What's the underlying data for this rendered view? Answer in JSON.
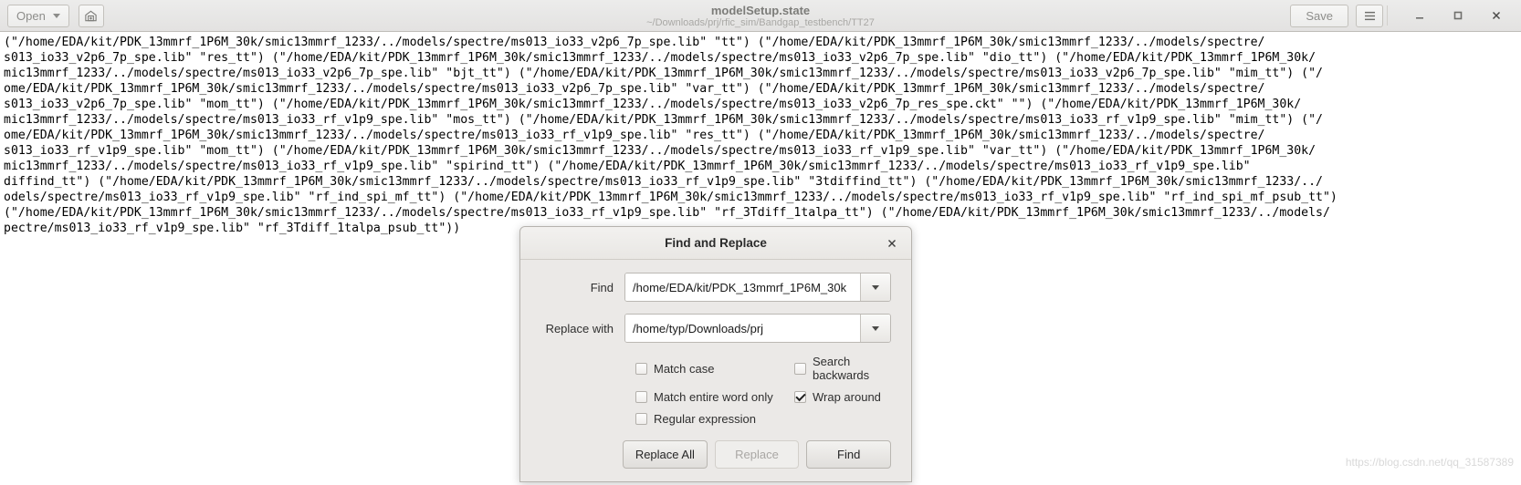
{
  "header": {
    "open_label": "Open",
    "open_caret_icon": "chevron-down-icon",
    "new_window_icon": "save-as-icon",
    "title": "modelSetup.state",
    "subtitle": "~/Downloads/prj/rfic_sim/Bandgap_testbench/TT27",
    "save_label": "Save",
    "menu_icon": "hamburger-menu-icon",
    "minimize_icon": "minimize-icon",
    "maximize_icon": "maximize-icon",
    "close_icon": "close-icon"
  },
  "editor": {
    "content": "(\"/home/EDA/kit/PDK_13mmrf_1P6M_30k/smic13mmrf_1233/../models/spectre/ms013_io33_v2p6_7p_spe.lib\" \"tt\") (\"/home/EDA/kit/PDK_13mmrf_1P6M_30k/smic13mmrf_1233/../models/spectre/\ns013_io33_v2p6_7p_spe.lib\" \"res_tt\") (\"/home/EDA/kit/PDK_13mmrf_1P6M_30k/smic13mmrf_1233/../models/spectre/ms013_io33_v2p6_7p_spe.lib\" \"dio_tt\") (\"/home/EDA/kit/PDK_13mmrf_1P6M_30k/\nmic13mmrf_1233/../models/spectre/ms013_io33_v2p6_7p_spe.lib\" \"bjt_tt\") (\"/home/EDA/kit/PDK_13mmrf_1P6M_30k/smic13mmrf_1233/../models/spectre/ms013_io33_v2p6_7p_spe.lib\" \"mim_tt\") (\"/\nome/EDA/kit/PDK_13mmrf_1P6M_30k/smic13mmrf_1233/../models/spectre/ms013_io33_v2p6_7p_spe.lib\" \"var_tt\") (\"/home/EDA/kit/PDK_13mmrf_1P6M_30k/smic13mmrf_1233/../models/spectre/\ns013_io33_v2p6_7p_spe.lib\" \"mom_tt\") (\"/home/EDA/kit/PDK_13mmrf_1P6M_30k/smic13mmrf_1233/../models/spectre/ms013_io33_v2p6_7p_res_spe.ckt\" \"\") (\"/home/EDA/kit/PDK_13mmrf_1P6M_30k/\nmic13mmrf_1233/../models/spectre/ms013_io33_rf_v1p9_spe.lib\" \"mos_tt\") (\"/home/EDA/kit/PDK_13mmrf_1P6M_30k/smic13mmrf_1233/../models/spectre/ms013_io33_rf_v1p9_spe.lib\" \"mim_tt\") (\"/\nome/EDA/kit/PDK_13mmrf_1P6M_30k/smic13mmrf_1233/../models/spectre/ms013_io33_rf_v1p9_spe.lib\" \"res_tt\") (\"/home/EDA/kit/PDK_13mmrf_1P6M_30k/smic13mmrf_1233/../models/spectre/\ns013_io33_rf_v1p9_spe.lib\" \"mom_tt\") (\"/home/EDA/kit/PDK_13mmrf_1P6M_30k/smic13mmrf_1233/../models/spectre/ms013_io33_rf_v1p9_spe.lib\" \"var_tt\") (\"/home/EDA/kit/PDK_13mmrf_1P6M_30k/\nmic13mmrf_1233/../models/spectre/ms013_io33_rf_v1p9_spe.lib\" \"spirind_tt\") (\"/home/EDA/kit/PDK_13mmrf_1P6M_30k/smic13mmrf_1233/../models/spectre/ms013_io33_rf_v1p9_spe.lib\"\ndiffind_tt\") (\"/home/EDA/kit/PDK_13mmrf_1P6M_30k/smic13mmrf_1233/../models/spectre/ms013_io33_rf_v1p9_spe.lib\" \"3tdiffind_tt\") (\"/home/EDA/kit/PDK_13mmrf_1P6M_30k/smic13mmrf_1233/../\nodels/spectre/ms013_io33_rf_v1p9_spe.lib\" \"rf_ind_spi_mf_tt\") (\"/home/EDA/kit/PDK_13mmrf_1P6M_30k/smic13mmrf_1233/../models/spectre/ms013_io33_rf_v1p9_spe.lib\" \"rf_ind_spi_mf_psub_tt\")\n(\"/home/EDA/kit/PDK_13mmrf_1P6M_30k/smic13mmrf_1233/../models/spectre/ms013_io33_rf_v1p9_spe.lib\" \"rf_3Tdiff_1talpa_tt\") (\"/home/EDA/kit/PDK_13mmrf_1P6M_30k/smic13mmrf_1233/../models/\npectre/ms013_io33_rf_v1p9_spe.lib\" \"rf_3Tdiff_1talpa_psub_tt\"))",
    "watermark": "https://blog.csdn.net/qq_31587389"
  },
  "dialog": {
    "title": "Find and Replace",
    "close_icon": "close-icon",
    "find_label": "Find",
    "find_value": "/home/EDA/kit/PDK_13mmrf_1P6M_30k",
    "find_placeholder": "",
    "find_dropdown_icon": "chevron-down-icon",
    "replace_label": "Replace with",
    "replace_value": "/home/typ/Downloads/prj",
    "replace_placeholder": "",
    "replace_dropdown_icon": "chevron-down-icon",
    "options": [
      {
        "label": "Match case",
        "checked": false
      },
      {
        "label": "Search backwards",
        "checked": false
      },
      {
        "label": "Match entire word only",
        "checked": false
      },
      {
        "label": "Wrap around",
        "checked": true
      },
      {
        "label": "Regular expression",
        "checked": false
      }
    ],
    "buttons": [
      {
        "label": "Replace All",
        "disabled": false
      },
      {
        "label": "Replace",
        "disabled": true
      },
      {
        "label": "Find",
        "disabled": false
      }
    ]
  }
}
